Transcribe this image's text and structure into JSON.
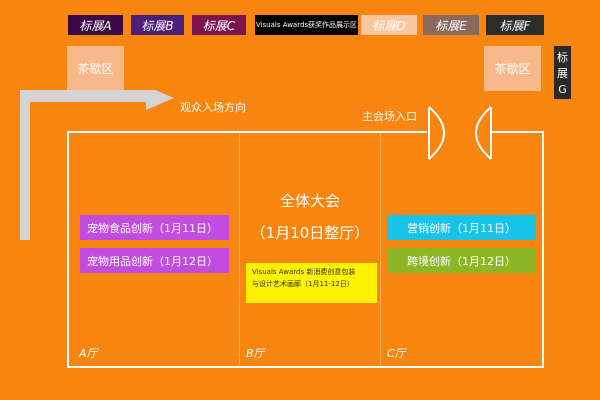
{
  "top_booths": [
    {
      "label": "标展A",
      "bg": "#3B0A45",
      "color": "#ffffff"
    },
    {
      "label": "标展B",
      "bg": "#4B1F7A",
      "color": "#ffffff"
    },
    {
      "label": "标展C",
      "bg": "#7A1550",
      "color": "#ffffff"
    },
    {
      "label": "Visuals Awards获奖作品展示区",
      "bg": "#000000",
      "color": "#ffffff"
    },
    {
      "label": "标展D",
      "bg": "#F8C7A0",
      "color": "#ffffff"
    },
    {
      "label": "标展E",
      "bg": "#8A6A5C",
      "color": "#ffffff"
    },
    {
      "label": "标展F",
      "bg": "#2B2B2B",
      "color": "#ffffff"
    }
  ],
  "teahouse_left": "茶歇区",
  "teahouse_right": "茶歇区",
  "booth_g": "标展G",
  "audience_direction": "观众入场方向",
  "main_entrance": "主会场入口",
  "halls": {
    "a": "A厅",
    "b": "B厅",
    "c": "C厅"
  },
  "plenary": {
    "line1": "全体大会",
    "line2": "（1月10日整厅）"
  },
  "hall_a_bars": [
    {
      "label": "宠物食品创新（1月11日）",
      "color": "#C24CE0"
    },
    {
      "label": "宠物用品创新（1月12日）",
      "color": "#C24CE0"
    }
  ],
  "hall_c_bars": [
    {
      "label": "营销创新（1月11日）",
      "color": "#17C3E8"
    },
    {
      "label": "跨境创新（1月12日）",
      "color": "#8CB724"
    }
  ],
  "yellow_box": {
    "line1": "Visuals Awards 新消费创意包装",
    "line2": "与设计艺术画廊（1月11-12日）"
  }
}
